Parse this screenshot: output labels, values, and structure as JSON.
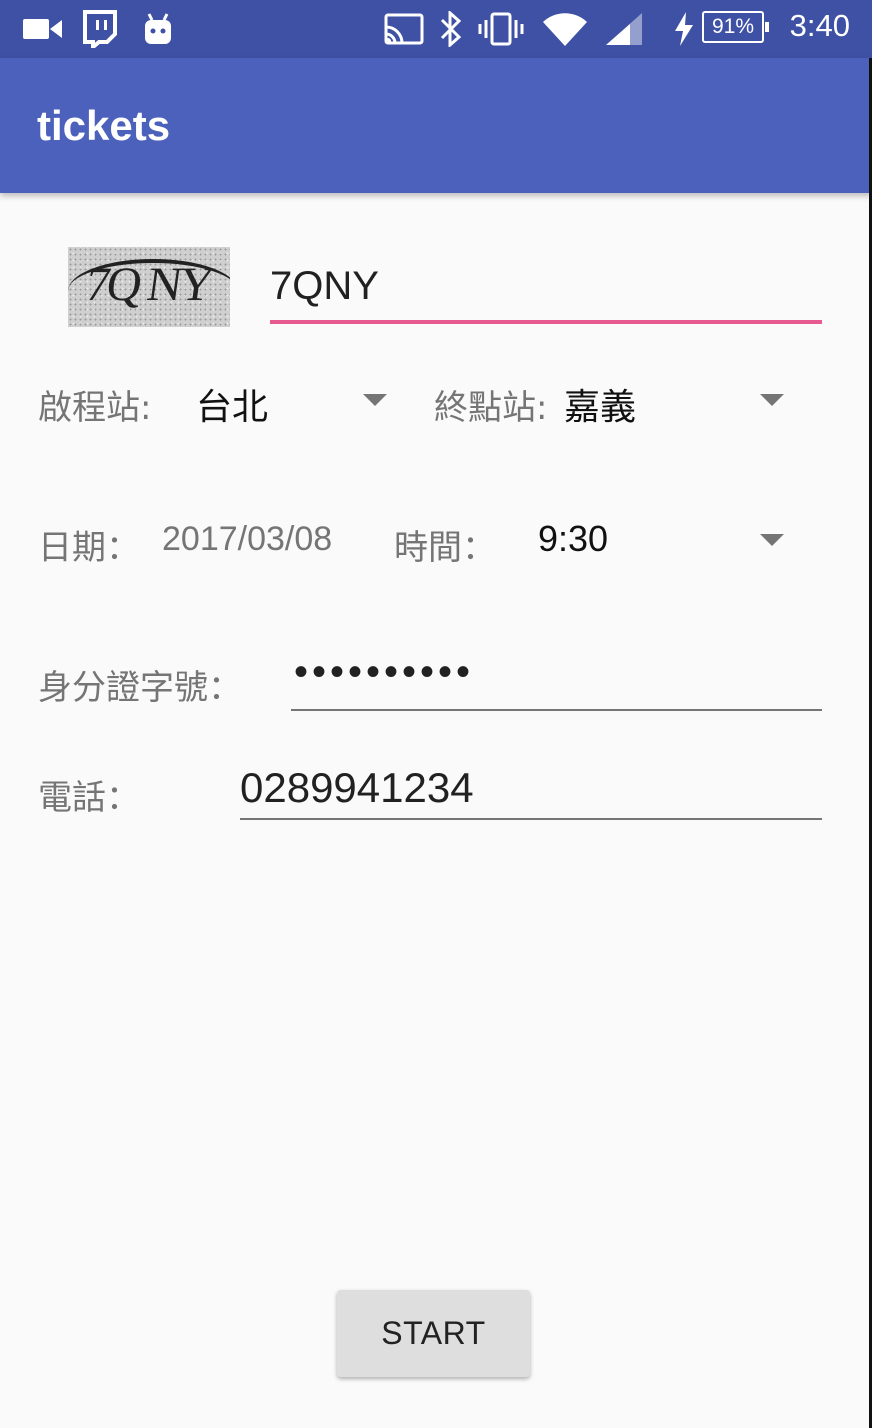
{
  "status_bar": {
    "time": "3:40",
    "battery_percent": "91%",
    "left_icons": [
      "video-camera-icon",
      "twitch-icon",
      "android-icon"
    ],
    "right_icons": [
      "cast-icon",
      "bluetooth-icon",
      "vibrate-icon",
      "wifi-icon",
      "signal-icon",
      "charging-icon"
    ]
  },
  "app_bar": {
    "title": "tickets"
  },
  "captcha": {
    "image_text": "7Q NY",
    "input_value": "7QNY"
  },
  "stations": {
    "from_label": "啟程站:",
    "from_value": "台北",
    "to_label": "終點站:",
    "to_value": "嘉義"
  },
  "schedule": {
    "date_label": "日期：",
    "date_value": "2017/03/08",
    "time_label": "時間：",
    "time_value": "9:30"
  },
  "id_number": {
    "label": "身分證字號：",
    "masked_value": "••••••••••"
  },
  "phone": {
    "label": "電話：",
    "value": "0289941234"
  },
  "actions": {
    "start_label": "START"
  },
  "colors": {
    "status_bar": "#3f51a5",
    "app_bar": "#4c61bb",
    "accent_underline": "#e75a8f",
    "background": "#fafafa"
  }
}
